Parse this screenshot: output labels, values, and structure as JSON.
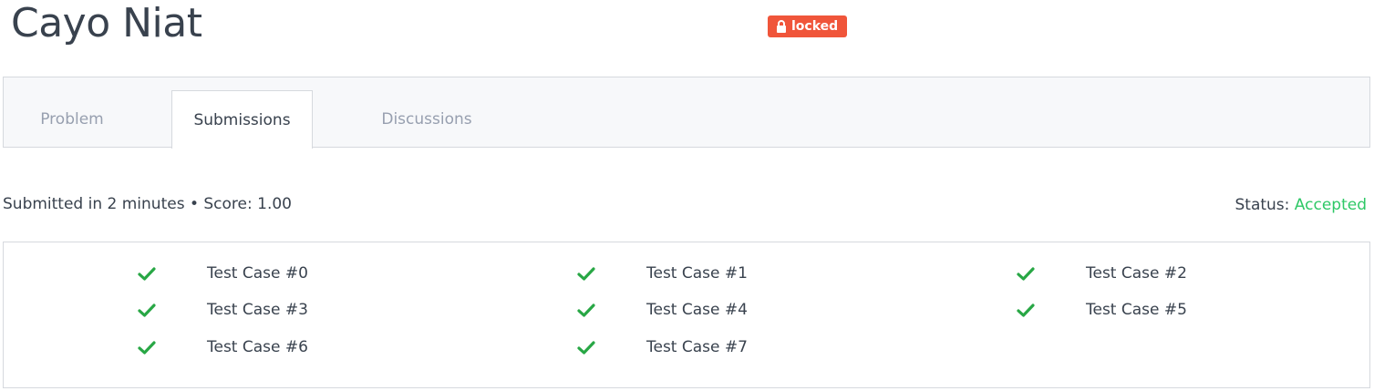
{
  "header": {
    "title": "Cayo Niat",
    "badge": "locked",
    "badge_color": "#f0553a"
  },
  "tabs": [
    {
      "label": "Problem",
      "active": false
    },
    {
      "label": "Submissions",
      "active": true
    },
    {
      "label": "Discussions",
      "active": false
    }
  ],
  "submission": {
    "meta": "Submitted in 2 minutes • Score: 1.00",
    "status_label": "Status:",
    "status_value": "Accepted",
    "status_color": "#2ec866"
  },
  "test_cases": [
    {
      "label": "Test Case #0",
      "passed": true
    },
    {
      "label": "Test Case #1",
      "passed": true
    },
    {
      "label": "Test Case #2",
      "passed": true
    },
    {
      "label": "Test Case #3",
      "passed": true
    },
    {
      "label": "Test Case #4",
      "passed": true
    },
    {
      "label": "Test Case #5",
      "passed": true
    },
    {
      "label": "Test Case #6",
      "passed": true
    },
    {
      "label": "Test Case #7",
      "passed": true
    }
  ],
  "icons": {
    "badge": "lock-icon",
    "test_case": "checkmark-icon"
  }
}
